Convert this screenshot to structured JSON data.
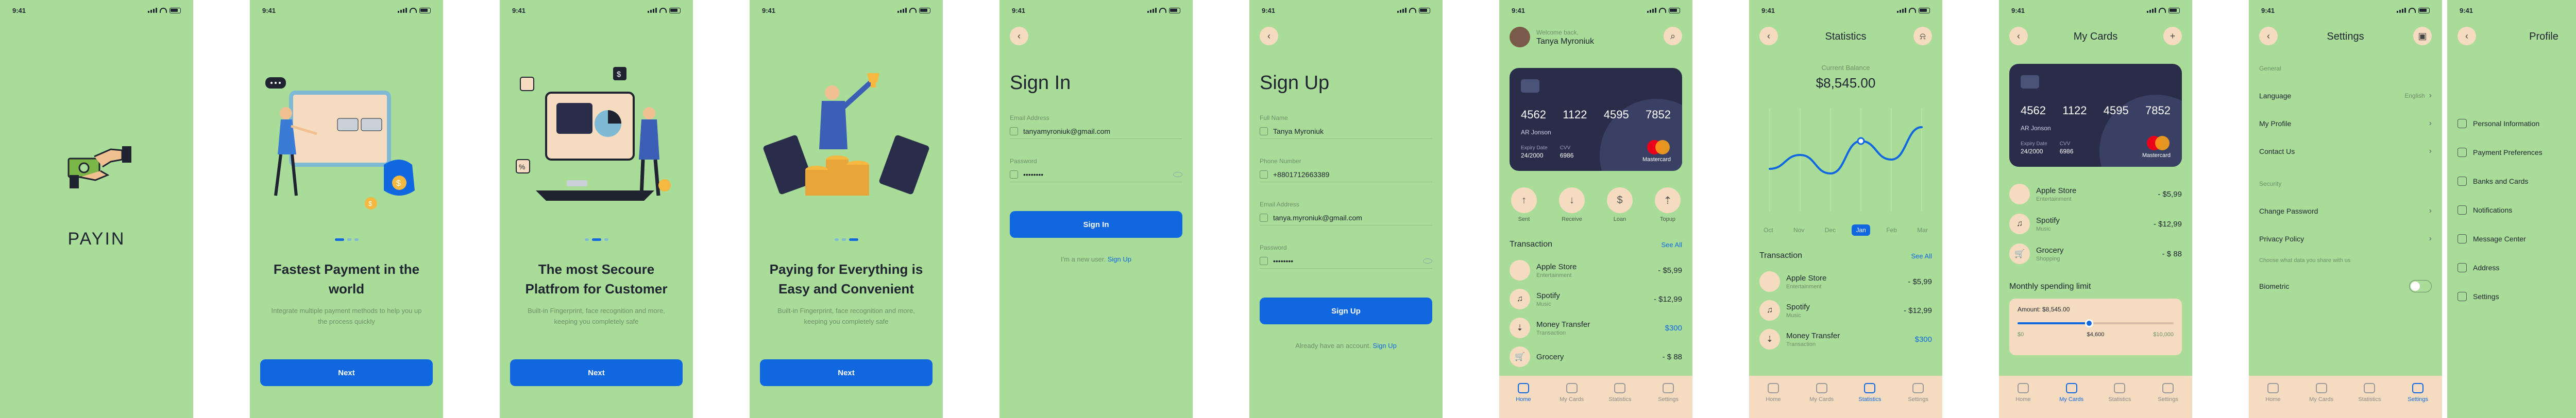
{
  "status_time": "9:41",
  "colors": {
    "bg": "#a8dc98",
    "accent": "#1167e0",
    "cream": "#f5dcc0",
    "card": "#2a2d4a",
    "red": "#e02020"
  },
  "splash": {
    "brand": "PAYIN"
  },
  "onboarding": [
    {
      "title": "Fastest Payment in the world",
      "subtitle": "Integrate multiple payment methods to help you up the process quickly",
      "button": "Next"
    },
    {
      "title": "The most Secoure Platfrom for Customer",
      "subtitle": "Built-in Fingerprint, face recognition and more, keeping you completely safe",
      "button": "Next"
    },
    {
      "title": "Paying for Everything is Easy and Convenient",
      "subtitle": "Built-in Fingerprint, face recognition and more, keeping you completely safe",
      "button": "Next"
    }
  ],
  "signin": {
    "title": "Sign In",
    "email_label": "Email Address",
    "email_value": "tanyamyroniuk@gmail.com",
    "password_label": "Password",
    "password_value": "••••••••",
    "button": "Sign In",
    "footer_text": "I'm a new user.",
    "footer_link": "Sign Up"
  },
  "signup": {
    "title": "Sign Up",
    "name_label": "Full Name",
    "name_value": "Tanya Myroniuk",
    "phone_label": "Phone Number",
    "phone_value": "+8801712663389",
    "email_label": "Email Address",
    "email_value": "tanya.myroniuk@gmail.com",
    "password_label": "Password",
    "password_value": "••••••••",
    "button": "Sign Up",
    "footer_text": "Already have an account.",
    "footer_link": "Sign Up"
  },
  "card": {
    "number": [
      "4562",
      "1122",
      "4595",
      "7852"
    ],
    "holder": "AR Jonson",
    "expiry_label": "Expiry Date",
    "expiry": "24/2000",
    "cvv_label": "CVV",
    "cvv": "6986",
    "brand": "Mastercard"
  },
  "home": {
    "welcome": "Welcome back,",
    "name": "Tanya Myroniuk",
    "actions": [
      "Sent",
      "Receive",
      "Loan",
      "Topup"
    ],
    "section": "Transaction",
    "see_all": "See All",
    "transactions": [
      {
        "name": "Apple Store",
        "cat": "Entertainment",
        "amount": "- $5,99",
        "icon": ""
      },
      {
        "name": "Spotify",
        "cat": "Music",
        "amount": "- $12,99",
        "icon": "♫"
      },
      {
        "name": "Money Transfer",
        "cat": "Transaction",
        "amount": "$300",
        "icon": "⇣"
      },
      {
        "name": "Grocery",
        "cat": "",
        "amount": "- $ 88",
        "icon": "🛒"
      }
    ]
  },
  "tabs": [
    "Home",
    "My Cards",
    "Statistics",
    "Settings"
  ],
  "stats": {
    "title": "Statistics",
    "balance_label": "Current Balance",
    "balance": "$8,545.00",
    "months": [
      "Oct",
      "Nov",
      "Dec",
      "Jan",
      "Feb",
      "Mar"
    ],
    "active_month": "Jan",
    "section": "Transaction",
    "see_all": "See All",
    "chart_data": {
      "type": "line",
      "categories": [
        "Oct",
        "Nov",
        "Dec",
        "Jan",
        "Feb",
        "Mar"
      ],
      "values": [
        40,
        55,
        35,
        70,
        50,
        85
      ],
      "title": "",
      "xlabel": "",
      "ylabel": ""
    },
    "transactions": [
      {
        "name": "Apple Store",
        "cat": "Entertainment",
        "amount": "- $5,99",
        "icon": ""
      },
      {
        "name": "Spotify",
        "cat": "Music",
        "amount": "- $12,99",
        "icon": "♫"
      },
      {
        "name": "Money Transfer",
        "cat": "Transaction",
        "amount": "$300",
        "icon": "⇣"
      }
    ]
  },
  "mycards": {
    "title": "My Cards",
    "transactions": [
      {
        "name": "Apple Store",
        "cat": "Entertainment",
        "amount": "- $5,99",
        "icon": ""
      },
      {
        "name": "Spotify",
        "cat": "Music",
        "amount": "- $12,99",
        "icon": "♫"
      },
      {
        "name": "Grocery",
        "cat": "Shopping",
        "amount": "- $ 88",
        "icon": "🛒"
      }
    ],
    "limit_title": "Monthly spending limit",
    "amount_label": "Amount: $8,545.00",
    "min": "$0",
    "mid": "$4,600",
    "max": "$10,000",
    "limit_fraction": 0.46
  },
  "settings": {
    "title": "Settings",
    "general": "General",
    "language": "Language",
    "language_value": "English",
    "profile": "My Profile",
    "contact": "Contact Us",
    "security": "Security",
    "change_password": "Change Password",
    "privacy": "Privacy Policy",
    "hint": "Choose what data you share with us",
    "biometric": "Biometric"
  },
  "profile": {
    "title": "Profile",
    "items": [
      "Personal Information",
      "Payment Preferences",
      "Banks and Cards",
      "Notifications",
      "Message Center",
      "Address",
      "Settings"
    ]
  }
}
